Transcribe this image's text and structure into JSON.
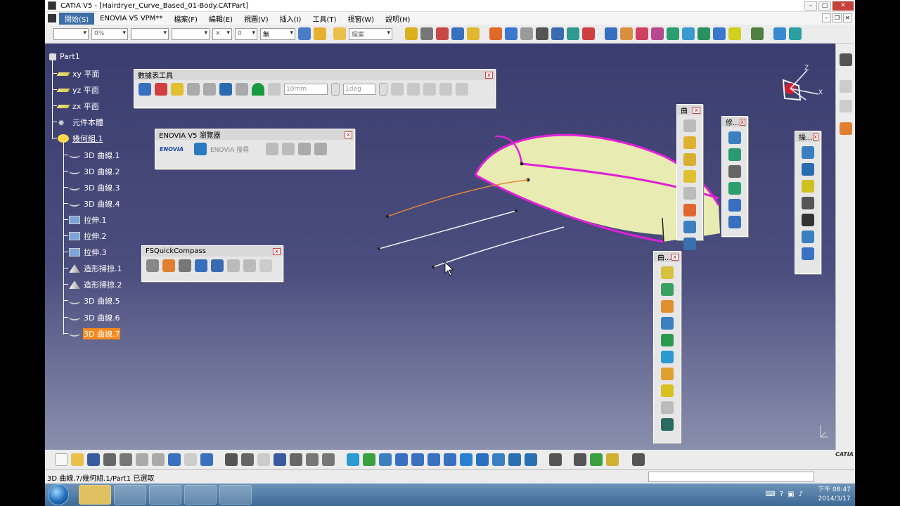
{
  "window": {
    "title": "CATIA V5 - [Hairdryer_Curve_Based_01-Body.CATPart]"
  },
  "menu": [
    "開始(S)",
    "ENOVIA V5 VPM**",
    "檔案(F)",
    "編輯(E)",
    "視圖(V)",
    "插入(I)",
    "工具(T)",
    "視窗(W)",
    "說明(H)"
  ],
  "toolbar_top": {
    "percent": "0%",
    "none_label": "無",
    "file_label": "檔案",
    "layer_num": "0"
  },
  "tree": {
    "root": "Part1",
    "items": [
      {
        "label": "xy 平面",
        "icon": "plane-icon"
      },
      {
        "label": "yz 平面",
        "icon": "plane-icon"
      },
      {
        "label": "zx 平面",
        "icon": "plane-icon"
      },
      {
        "label": "元件本體",
        "icon": "gear-icon"
      },
      {
        "label": "幾何組.1",
        "icon": "geometric-set-icon"
      },
      {
        "label": "3D 曲線.1",
        "icon": "curve-icon"
      },
      {
        "label": "3D 曲線.2",
        "icon": "curve-icon"
      },
      {
        "label": "3D 曲線.3",
        "icon": "curve-icon"
      },
      {
        "label": "3D 曲線.4",
        "icon": "curve-icon"
      },
      {
        "label": "拉伸.1",
        "icon": "extrude-icon"
      },
      {
        "label": "拉伸.2",
        "icon": "extrude-icon"
      },
      {
        "label": "拉伸.3",
        "icon": "extrude-icon"
      },
      {
        "label": "造形掃掠.1",
        "icon": "sweep-icon"
      },
      {
        "label": "造形掃掠.2",
        "icon": "sweep-icon"
      },
      {
        "label": "3D 曲線.5",
        "icon": "curve-icon"
      },
      {
        "label": "3D 曲線.6",
        "icon": "curve-icon"
      },
      {
        "label": "3D 曲線.7",
        "icon": "curve-icon"
      }
    ]
  },
  "panels": {
    "tools": {
      "title": "數據表工具",
      "field1": "10mm",
      "field2": "1deg"
    },
    "enovia": {
      "title": "ENOVIA V5 瀏覽器",
      "search": "ENOVIA 搜尋",
      "logo": "ENOVIA"
    },
    "compass": {
      "title": "FSQuickCompass"
    },
    "curves": {
      "title": "曲"
    },
    "modify": {
      "title": "修..."
    },
    "surfaces": {
      "title": "曲..."
    },
    "operations": {
      "title": "操..."
    }
  },
  "status": {
    "text": "3D 曲線.7/幾何組.1/Part1 已選取"
  },
  "taskbar": {
    "time": "下午 08:47",
    "date": "2014/3/17"
  },
  "logo": "CATIA",
  "colors": {
    "background_top": "#3b3d70",
    "surface": "#ecf0b5",
    "edge": "#e020d8",
    "selection": "#f58a1e"
  }
}
